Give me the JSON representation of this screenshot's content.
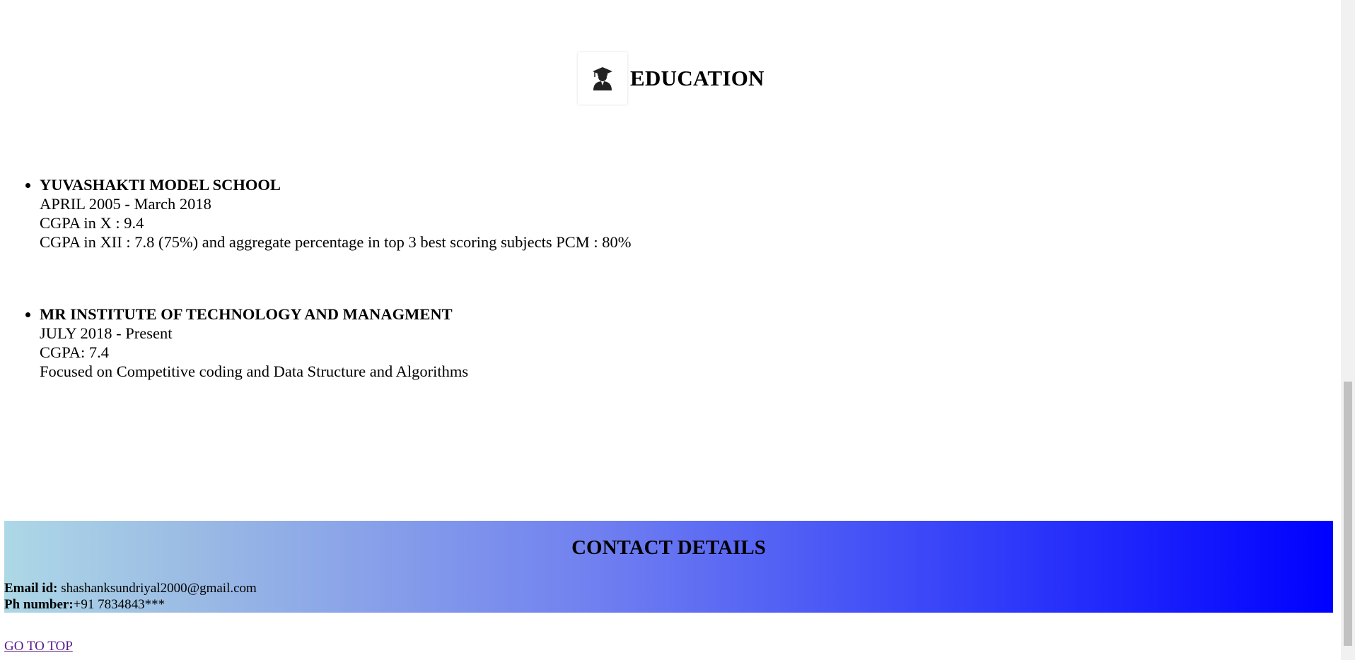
{
  "education": {
    "title": "EDUCATION",
    "icon": "graduate-icon",
    "items": [
      {
        "name": "YUVASHAKTI MODEL SCHOOL",
        "period": "APRIL 2005 - March 2018",
        "line1": "CGPA in X : 9.4",
        "line2": "CGPA in XII : 7.8 (75%) and aggregate percentage in top 3 best scoring subjects PCM : 80%"
      },
      {
        "name": "MR INSTITUTE OF TECHNOLOGY AND MANAGMENT",
        "period": "JULY 2018 - Present",
        "line1": "CGPA: 7.4",
        "line2": "Focused on Competitive coding and Data Structure and Algorithms"
      }
    ]
  },
  "contact": {
    "title": "CONTACT DETAILS",
    "email_label": "Email id:",
    "email_value": " shashanksundriyal2000@gmail.com",
    "phone_label": "Ph number:",
    "phone_value": "+91 7834843***"
  },
  "go_top_label": "GO TO TOP",
  "colors": {
    "gradient_start": "#add8e6",
    "gradient_end": "#0000ff",
    "visited_link": "#551a8b"
  }
}
